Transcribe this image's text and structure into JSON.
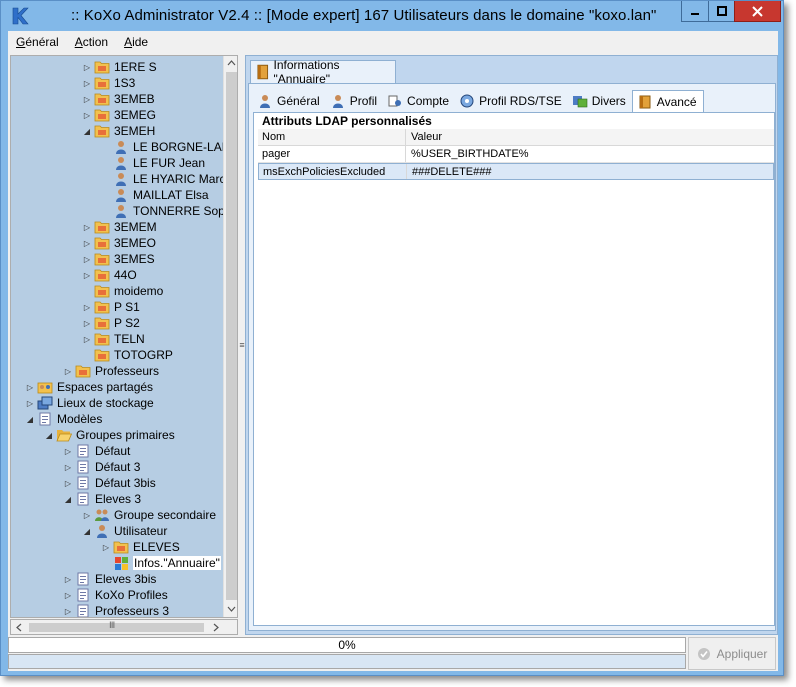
{
  "window": {
    "title": ":: KoXo Administrator V2.4 :: [Mode expert] 167 Utilisateurs dans le domaine \"koxo.lan\"",
    "min_glyph": "▁",
    "max_glyph": "☐",
    "close_glyph": "✕"
  },
  "menu": [
    {
      "label": "Général",
      "underline": "G"
    },
    {
      "label": "Action",
      "underline": "A"
    },
    {
      "label": "Aide",
      "underline": "A"
    }
  ],
  "tree": [
    {
      "label": "1ERE S",
      "indent": 3,
      "icon": "folder-icon",
      "arrow": "▷"
    },
    {
      "label": "1S3",
      "indent": 3,
      "icon": "folder-icon",
      "arrow": "▷"
    },
    {
      "label": "3EMEB",
      "indent": 3,
      "icon": "folder-icon",
      "arrow": "▷"
    },
    {
      "label": "3EMEG",
      "indent": 3,
      "icon": "folder-icon",
      "arrow": "▷"
    },
    {
      "label": "3EMEH",
      "indent": 3,
      "icon": "folder-icon",
      "arrow": "◢"
    },
    {
      "label": "LE BORGNE-LARIVI",
      "indent": 4,
      "icon": "user-icon",
      "arrow": ""
    },
    {
      "label": "LE FUR Jean",
      "indent": 4,
      "icon": "user-icon",
      "arrow": ""
    },
    {
      "label": "LE HYARIC Marc",
      "indent": 4,
      "icon": "user-icon",
      "arrow": ""
    },
    {
      "label": "MAILLAT Elsa",
      "indent": 4,
      "icon": "user-icon",
      "arrow": ""
    },
    {
      "label": "TONNERRE Sophie",
      "indent": 4,
      "icon": "user-icon",
      "arrow": ""
    },
    {
      "label": "3EMEM",
      "indent": 3,
      "icon": "folder-icon",
      "arrow": "▷"
    },
    {
      "label": "3EMEO",
      "indent": 3,
      "icon": "folder-icon",
      "arrow": "▷"
    },
    {
      "label": "3EMES",
      "indent": 3,
      "icon": "folder-icon",
      "arrow": "▷"
    },
    {
      "label": "44O",
      "indent": 3,
      "icon": "folder-icon",
      "arrow": "▷"
    },
    {
      "label": "moidemo",
      "indent": 3,
      "icon": "folder-icon",
      "arrow": ""
    },
    {
      "label": "P S1",
      "indent": 3,
      "icon": "folder-icon",
      "arrow": "▷"
    },
    {
      "label": "P S2",
      "indent": 3,
      "icon": "folder-icon",
      "arrow": "▷"
    },
    {
      "label": "TELN",
      "indent": 3,
      "icon": "folder-icon",
      "arrow": "▷"
    },
    {
      "label": "TOTOGRP",
      "indent": 3,
      "icon": "folder-icon",
      "arrow": ""
    },
    {
      "label": "Professeurs",
      "indent": 2,
      "icon": "folder-icon",
      "arrow": "▷"
    },
    {
      "label": "Espaces partagés",
      "indent": 0,
      "icon": "shared-space-icon",
      "arrow": "▷"
    },
    {
      "label": "Lieux de stockage",
      "indent": 0,
      "icon": "storage-icon",
      "arrow": "▷"
    },
    {
      "label": "Modèles",
      "indent": 0,
      "icon": "template-icon",
      "arrow": "◢"
    },
    {
      "label": "Groupes primaires",
      "indent": 1,
      "icon": "open-folder-icon",
      "arrow": "◢"
    },
    {
      "label": "Défaut",
      "indent": 2,
      "icon": "template-icon",
      "arrow": "▷"
    },
    {
      "label": "Défaut 3",
      "indent": 2,
      "icon": "template-icon",
      "arrow": "▷"
    },
    {
      "label": "Défaut 3bis",
      "indent": 2,
      "icon": "template-icon",
      "arrow": "▷"
    },
    {
      "label": "Eleves 3",
      "indent": 2,
      "icon": "template-icon",
      "arrow": "◢"
    },
    {
      "label": "Groupe secondaire",
      "indent": 3,
      "icon": "group-icon",
      "arrow": "▷"
    },
    {
      "label": "Utilisateur",
      "indent": 3,
      "icon": "user-icon",
      "arrow": "◢"
    },
    {
      "label": "ELEVES",
      "indent": 4,
      "icon": "folder-icon",
      "arrow": "▷"
    },
    {
      "label": "Infos.\"Annuaire\"",
      "indent": 4,
      "icon": "windows-icon",
      "arrow": "",
      "selected": true
    },
    {
      "label": "Eleves 3bis",
      "indent": 2,
      "icon": "template-icon",
      "arrow": "▷"
    },
    {
      "label": "KoXo Profiles",
      "indent": 2,
      "icon": "template-icon",
      "arrow": "▷"
    },
    {
      "label": "Professeurs 3",
      "indent": 2,
      "icon": "template-icon",
      "arrow": "▷"
    }
  ],
  "outer_tab": {
    "label": "Informations \"Annuaire\""
  },
  "tabs": [
    {
      "label": "Général",
      "icon": "user-icon"
    },
    {
      "label": "Profil",
      "icon": "user-icon"
    },
    {
      "label": "Compte",
      "icon": "account-icon"
    },
    {
      "label": "Profil RDS/TSE",
      "icon": "rds-icon"
    },
    {
      "label": "Divers",
      "icon": "misc-icon"
    },
    {
      "label": "Avancé",
      "icon": "book-icon",
      "active": true
    }
  ],
  "ldap": {
    "group_title": "Attributs LDAP personnalisés",
    "columns": [
      "Nom",
      "Valeur"
    ],
    "rows": [
      {
        "name": "pager",
        "value": "%USER_BIRTHDATE%"
      },
      {
        "name": "msExchPoliciesExcluded",
        "value": "###DELETE###"
      }
    ]
  },
  "status": {
    "progress_text": "0%",
    "apply_label": "Appliquer"
  },
  "scroll": {
    "splitter_glyph": "≡",
    "hscroll_mid_glyph": "Ⅲ"
  },
  "colors": {
    "title_bar": "#82b8e8",
    "close": "#c7372f",
    "tree_bg": "#b6cde3",
    "panel": "#c0d6ee"
  }
}
